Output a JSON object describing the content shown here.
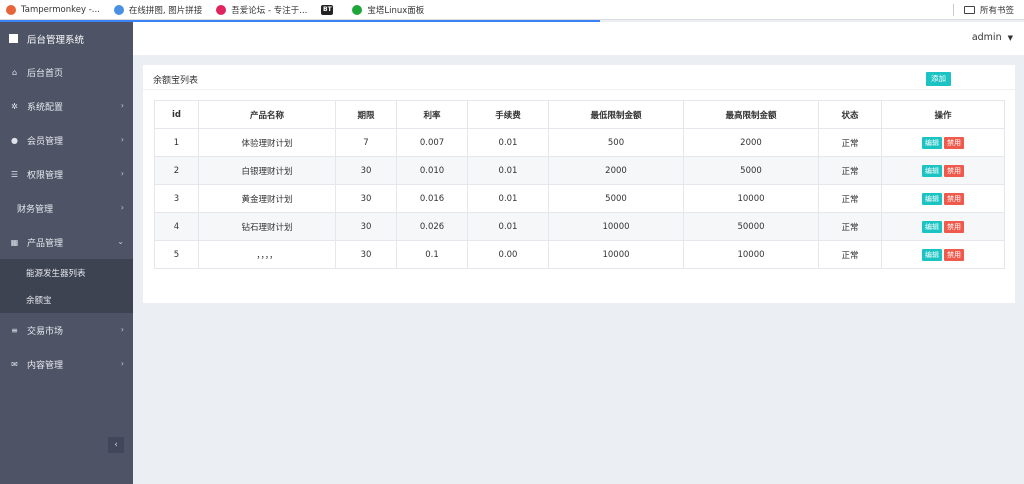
{
  "bookmarks": {
    "items": [
      {
        "label": "Tampermonkey -...",
        "icon": "tampermonkey-icon",
        "color": "#e8643a"
      },
      {
        "label": "在线拼图, 图片拼接",
        "icon": "cloud-icon",
        "color": "#4a90e2"
      },
      {
        "label": "吾爱论坛 - 专注于...",
        "icon": "forum-icon",
        "color": "#e0245e"
      },
      {
        "label": "",
        "icon": "bt-icon",
        "badge": "BT"
      },
      {
        "label": "宝塔Linux面板",
        "icon": "baota-icon",
        "color": "#20a53a"
      }
    ],
    "all_bookmarks": "所有书签"
  },
  "sidebar": {
    "brand": "后台管理系统",
    "items": [
      {
        "label": "后台首页",
        "icon": "home-icon",
        "glyph": "⌂",
        "chevron": ""
      },
      {
        "label": "系统配置",
        "icon": "cogs-icon",
        "glyph": "✲",
        "chevron": "›"
      },
      {
        "label": "会员管理",
        "icon": "user-icon",
        "glyph": "●",
        "chevron": "›"
      },
      {
        "label": "权限管理",
        "icon": "list-icon",
        "glyph": "☰",
        "chevron": "›"
      },
      {
        "label": "财务管理",
        "icon": "",
        "glyph": "",
        "chevron": "›"
      },
      {
        "label": "产品管理",
        "icon": "windows-icon",
        "glyph": "▦",
        "chevron": "⌄"
      }
    ],
    "submenu": [
      "能源发生器列表",
      "余额宝"
    ],
    "items_after": [
      {
        "label": "交易市场",
        "icon": "bars-icon",
        "glyph": "≡",
        "chevron": "›"
      },
      {
        "label": "内容管理",
        "icon": "envelope-icon",
        "glyph": "✉",
        "chevron": "›"
      }
    ],
    "collapse_glyph": "‹"
  },
  "header": {
    "user": "admin",
    "caret": "▼"
  },
  "panel": {
    "title": "余额宝列表",
    "add_label": "添加",
    "columns": [
      "id",
      "产品名称",
      "期限",
      "利率",
      "手续费",
      "最低限制金额",
      "最高限制金额",
      "状态",
      "操作"
    ],
    "rows": [
      [
        "1",
        "体验理财计划",
        "7",
        "0.007",
        "0.01",
        "500",
        "2000",
        "正常"
      ],
      [
        "2",
        "白银理财计划",
        "30",
        "0.010",
        "0.01",
        "2000",
        "5000",
        "正常"
      ],
      [
        "3",
        "黄金理财计划",
        "30",
        "0.016",
        "0.01",
        "5000",
        "10000",
        "正常"
      ],
      [
        "4",
        "钻石理财计划",
        "30",
        "0.026",
        "0.01",
        "10000",
        "50000",
        "正常"
      ],
      [
        "5",
        "，，，，",
        "30",
        "0.1",
        "0.00",
        "10000",
        "10000",
        "正常"
      ]
    ],
    "edit_label": "编辑",
    "ban_label": "禁用"
  }
}
